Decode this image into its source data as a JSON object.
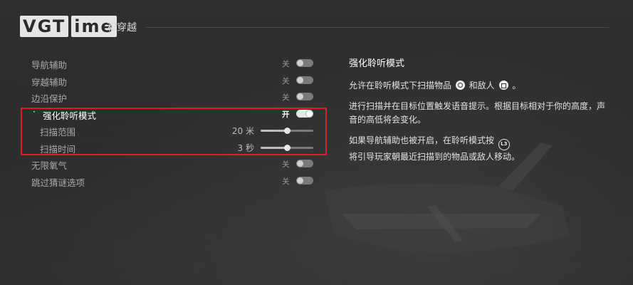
{
  "logo": {
    "blocks": [
      "VGT",
      "ime"
    ]
  },
  "header": {
    "title": "和穿越"
  },
  "settings": [
    {
      "label": "导航辅助",
      "state": "关",
      "on": false,
      "type": "toggle"
    },
    {
      "label": "穿越辅助",
      "state": "关",
      "on": false,
      "type": "toggle"
    },
    {
      "label": "边沿保护",
      "state": "关",
      "on": false,
      "type": "toggle"
    },
    {
      "label": "强化聆听模式",
      "state": "开",
      "on": true,
      "type": "toggle",
      "active": true
    },
    {
      "label": "扫描范围",
      "value": "20 米",
      "level": 0.5,
      "type": "slider"
    },
    {
      "label": "扫描时间",
      "value": "3 秒",
      "level": 0.5,
      "type": "slider"
    },
    {
      "label": "无限氧气",
      "state": "关",
      "on": false,
      "type": "toggle"
    },
    {
      "label": "跳过猜谜选项",
      "state": "关",
      "on": false,
      "type": "toggle"
    }
  ],
  "description": {
    "title": "强化聆听模式",
    "p1_a": "允许在聆听模式下扫描物品",
    "p1_b": "和敌人",
    "p1_c": "。",
    "p2": "进行扫描并在目标位置触发语音提示。根据目标相对于你的高度，声音的高低将会变化。",
    "p3_a": "如果导航辅助也被开启，在聆听模式按",
    "p3_b": "将引导玩家朝最近扫描到的物品或敌人移动。",
    "l3_label": "L3"
  },
  "icons": {
    "circle_button": "circle-button-icon",
    "square_button": "square-button-icon",
    "l3_button": "l3-button-icon"
  },
  "colors": {
    "highlight": "#d8202b"
  }
}
